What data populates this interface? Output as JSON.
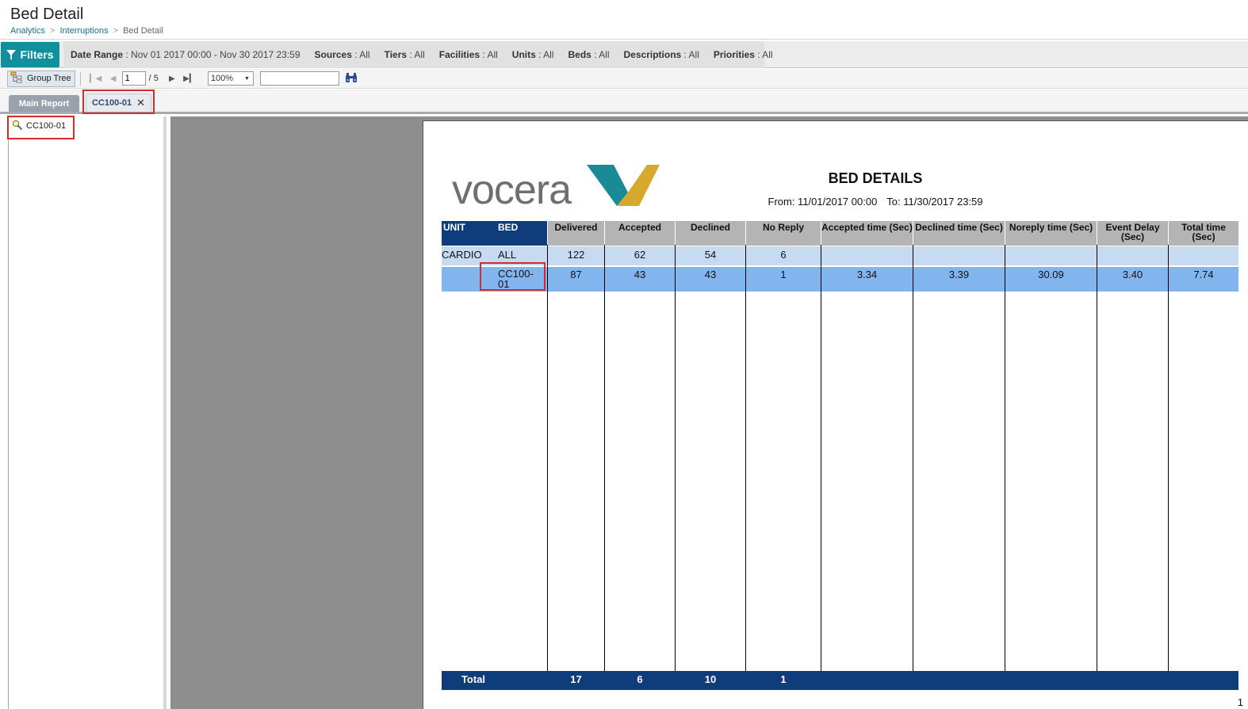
{
  "header": {
    "title": "Bed Detail",
    "breadcrumb": [
      "Analytics",
      "Interruptions",
      "Bed Detail"
    ]
  },
  "filters": {
    "button_label": "Filters",
    "items": [
      {
        "key": "Date Range",
        "value": "Nov 01 2017 00:00 - Nov 30 2017 23:59"
      },
      {
        "key": "Sources",
        "value": "All"
      },
      {
        "key": "Tiers",
        "value": "All"
      },
      {
        "key": "Facilities",
        "value": "All"
      },
      {
        "key": "Units",
        "value": "All"
      },
      {
        "key": "Beds",
        "value": "All"
      },
      {
        "key": "Descriptions",
        "value": "All"
      },
      {
        "key": "Priorities",
        "value": "All"
      }
    ]
  },
  "toolbar": {
    "group_tree_label": "Group Tree",
    "page_value": "1",
    "page_total": "/ 5",
    "zoom": "100%",
    "search_value": ""
  },
  "tabs": [
    {
      "label": "Main Report"
    },
    {
      "label": "CC100-01",
      "closable": true
    }
  ],
  "group_tree": {
    "nodes": [
      "CC100-01"
    ]
  },
  "report": {
    "logo_text": "vocera",
    "title": "BED DETAILS",
    "from": "From: 11/01/2017 00:00",
    "to": "To: 11/30/2017 23:59",
    "columns": [
      "UNIT",
      "BED",
      "Delivered",
      "Accepted",
      "Declined",
      "No Reply",
      "Accepted time (Sec)",
      "Declined time (Sec)",
      "Noreply time (Sec)",
      "Event Delay (Sec)",
      "Total time (Sec)"
    ],
    "rows": [
      [
        "CARDIO",
        "ALL",
        "122",
        "62",
        "54",
        "6",
        "",
        "",
        "",
        "",
        ""
      ],
      [
        "",
        "CC100-01",
        "87",
        "43",
        "43",
        "1",
        "3.34",
        "3.39",
        "30.09",
        "3.40",
        "7.74"
      ]
    ],
    "total": [
      "Total",
      "",
      "17",
      "6",
      "10",
      "1",
      "",
      "",
      "",
      "",
      ""
    ],
    "page_number": "1"
  },
  "colors": {
    "accent": "#108f9c",
    "report_header_blue": "#0f3d7c",
    "row_light": "#c6dbf2",
    "row_selected": "#82b4ee",
    "highlight": "#d62b2b"
  }
}
